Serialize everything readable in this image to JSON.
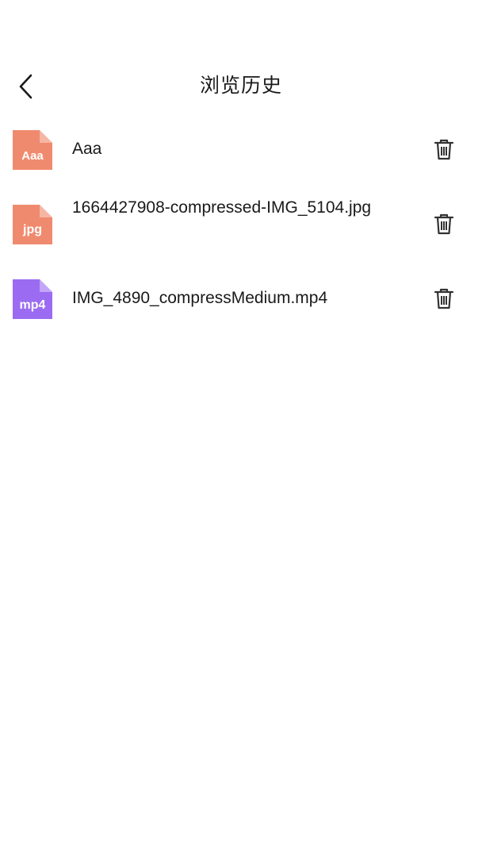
{
  "header": {
    "title": "浏览历史",
    "back_icon": "chevron-left-icon"
  },
  "files": [
    {
      "name": "Aaa",
      "icon_label": "Aaa",
      "icon_color": "#F08A6E",
      "icon_fold_color": "#F6B6A4",
      "delete_icon": "trash-icon"
    },
    {
      "name": "1664427908-compressed-IMG_5104.jpg",
      "icon_label": "jpg",
      "icon_color": "#F08A6E",
      "icon_fold_color": "#F6B6A4",
      "delete_icon": "trash-icon"
    },
    {
      "name": "IMG_4890_compressMedium.mp4",
      "icon_label": "mp4",
      "icon_color": "#9B6CF2",
      "icon_fold_color": "#C3A6F8",
      "delete_icon": "trash-icon"
    }
  ]
}
